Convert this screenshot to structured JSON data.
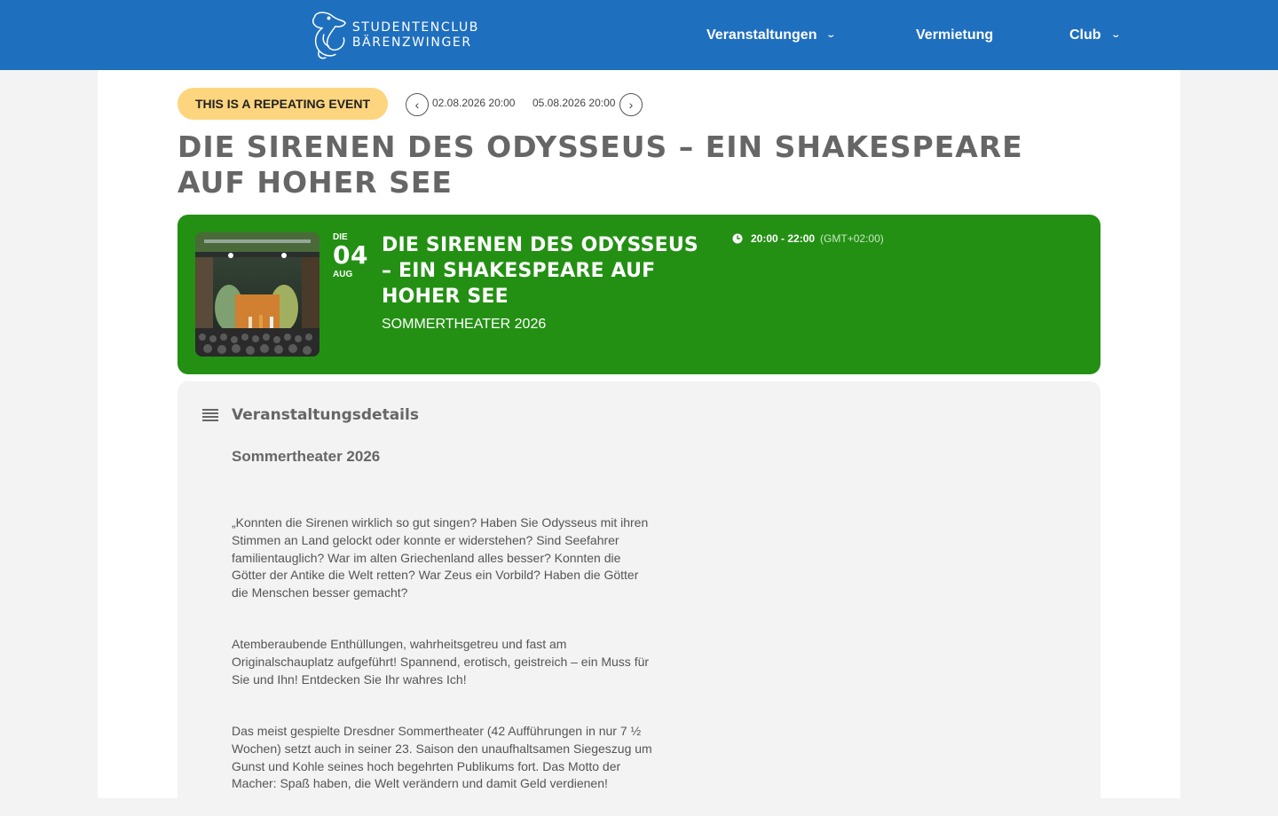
{
  "header": {
    "logo_line1": "STUDENTENCLUB",
    "logo_line2": "BÄRENZWINGER",
    "nav": [
      {
        "label": "Veranstaltungen",
        "has_dropdown": true
      },
      {
        "label": "Vermietung",
        "has_dropdown": false
      },
      {
        "label": "Club",
        "has_dropdown": true
      }
    ],
    "color": "#1f6fbf"
  },
  "event": {
    "repeat_badge": "THIS IS A REPEATING EVENT",
    "prev_date": "02.08.2026 20:00",
    "next_date": "05.08.2026 20:00",
    "title": "DIE SIRENEN DES ODYSSEUS – EIN SHAKESPEARE AUF HOHER SEE",
    "card": {
      "dow": "DIE",
      "day": "04",
      "month": "AUG",
      "title": "DIE SIRENEN DES ODYSSEUS – EIN SHAKESPEARE AUF HOHER SEE",
      "subtitle": "SOMMERTHEATER 2026",
      "time": "20:00 - 22:00",
      "timezone": "(GMT+02:00)",
      "color": "#239013"
    }
  },
  "details": {
    "heading": "Veranstaltungsdetails",
    "subheading": "Sommertheater 2026",
    "paragraphs": [
      "„Konnten die Sirenen wirklich so gut singen? Haben Sie Odysseus mit ihren Stimmen an Land gelockt oder konnte er widerstehen? Sind Seefahrer familientauglich? War im alten Griechenland alles besser? Konnten die Götter der Antike die Welt retten? War Zeus ein Vorbild? Haben die Götter die Menschen besser gemacht?",
      "Atemberaubende Enthüllungen, wahrheitsgetreu und fast am Originalschauplatz aufgeführt! Spannend, erotisch, geistreich – ein Muss für Sie und Ihn! Entdecken Sie Ihr wahres Ich!",
      "Das meist gespielte Dresdner Sommertheater (42 Aufführungen in nur 7 ½ Wochen) setzt auch in seiner 23. Saison den unaufhaltsamen Siegeszug um Gunst und Kohle seines hoch begehrten Publikums fort. Das Motto der Macher: Spaß haben, die Welt verändern und damit Geld verdienen!"
    ]
  }
}
